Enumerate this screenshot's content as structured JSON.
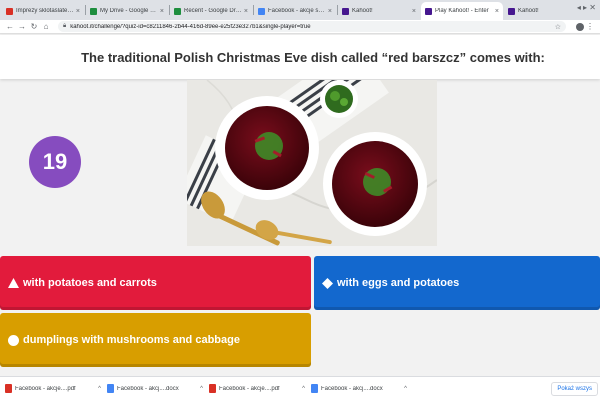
{
  "browser": {
    "tabs": [
      {
        "title": "Imprezy sklotaślatesta",
        "color": "#d93025",
        "active": false
      },
      {
        "title": "My Drive - Google Drive",
        "color": "#1e8e3e",
        "active": false
      },
      {
        "title": "Recent - Google Drive",
        "color": "#1e8e3e",
        "active": false
      },
      {
        "title": "Facebook - akcje świąt",
        "color": "#4285f4",
        "active": false
      },
      {
        "title": "Kahoot!",
        "color": "#46178f",
        "active": false
      },
      {
        "title": "Play Kahoot! - Enter",
        "color": "#46178f",
        "active": true
      },
      {
        "title": "Kahoot!",
        "color": "#46178f",
        "active": false
      }
    ],
    "url": "kahoot.it/challenge/?quiz-id=c8211846-2b44-416d-89ee-e25f23e327b1&single-player=true"
  },
  "quiz": {
    "question": "The traditional Polish Christmas Eve dish called “red barszcz” comes with:",
    "timer": "19",
    "answers": [
      {
        "text": "with potatoes and carrots",
        "shape": "triangle",
        "color": "#e21b3c"
      },
      {
        "text": "with eggs and potatoes",
        "shape": "diamond",
        "color": "#1368ce"
      },
      {
        "text": "dumplings with mushrooms and cabbage",
        "shape": "circle",
        "color": "#d89e00"
      }
    ]
  },
  "downloads": {
    "items": [
      {
        "name": "Facebook - akcje....pdf",
        "color": "#d93025"
      },
      {
        "name": "Facebook - akcj....docx",
        "color": "#4285f4"
      },
      {
        "name": "Facebook - akcje....pdf",
        "color": "#d93025"
      },
      {
        "name": "Facebook - akcj....docx",
        "color": "#4285f4"
      }
    ],
    "show_all": "Pokaż wszys"
  }
}
